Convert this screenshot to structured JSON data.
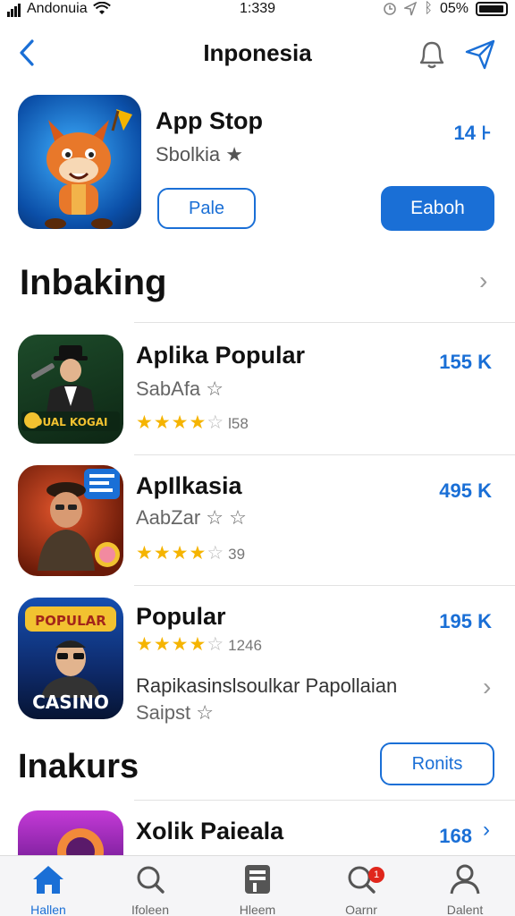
{
  "status_bar": {
    "carrier": "Andonuia",
    "time": "1:339",
    "battery": "05%"
  },
  "nav": {
    "title": "Inponesia"
  },
  "featured": {
    "name": "App Stop",
    "subtitle": "Sbolkia ★",
    "size": "14 ⊦",
    "button_outline_label": "Pale",
    "button_primary_label": "Eaboh"
  },
  "section1": {
    "title": "Inbaking",
    "items": [
      {
        "title": "Aplika Popular",
        "subtitle": "SabAfa ☆",
        "rating": 4,
        "count": "l58",
        "size": "155 K"
      },
      {
        "title": "ApIlkasia",
        "subtitle": "AabZar ☆ ☆",
        "rating": 4,
        "count": "39",
        "size": "495 K"
      },
      {
        "title": "Popular",
        "rating": 4,
        "count": "1246",
        "size": "195 K",
        "description": "Rapikasinslsoulkar Papollaian",
        "subtitle": "Saipst ☆"
      }
    ]
  },
  "section2": {
    "title": "Inakurs",
    "button_label": "Ronits",
    "items": [
      {
        "title": "Xolik Paieala",
        "size": "168"
      }
    ]
  },
  "tabs": [
    {
      "label": "Hallen",
      "icon": "home-icon",
      "active": true
    },
    {
      "label": "Ifoleen",
      "icon": "search-icon",
      "active": false
    },
    {
      "label": "Hleem",
      "icon": "apps-icon",
      "active": false
    },
    {
      "label": "Oarnr",
      "icon": "updates-search-icon",
      "active": false,
      "badge": "1"
    },
    {
      "label": "Dalent",
      "icon": "account-icon",
      "active": false
    }
  ],
  "colors": {
    "accent": "#1a6fd6",
    "star": "#f5b400",
    "badge": "#e0261c"
  }
}
